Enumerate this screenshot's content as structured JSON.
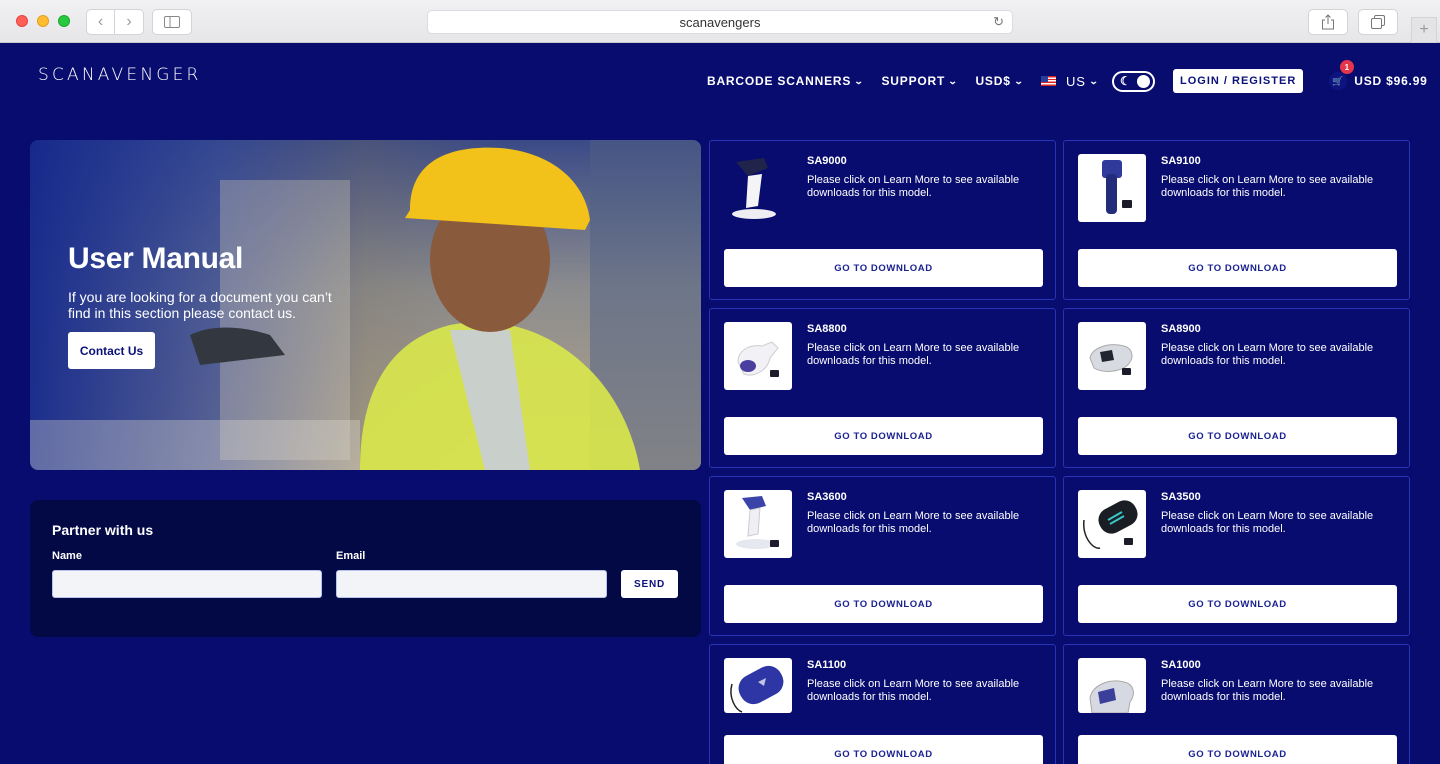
{
  "browser": {
    "url": "scanavengers"
  },
  "header": {
    "logo": "SCANAVENGER",
    "nav": [
      {
        "label": "BARCODE SCANNERS"
      },
      {
        "label": "SUPPORT"
      },
      {
        "label": "USD$"
      },
      {
        "label": "US"
      }
    ],
    "login_label": "LOGIN / REGISTER",
    "cart": {
      "count": "1",
      "total": "USD $96.99"
    }
  },
  "hero": {
    "title": "User Manual",
    "text": "If you are looking for a document you can’t find in this section please contact us.",
    "button": "Contact Us"
  },
  "partner": {
    "title": "Partner with us",
    "name_label": "Name",
    "email_label": "Email",
    "send_label": "SEND"
  },
  "products": [
    {
      "name": "SA9000",
      "desc": "Please click on Learn More to see available downloads for this model.",
      "button": "GO TO DOWNLOAD",
      "thumb_icon": "stand-scanner-icon"
    },
    {
      "name": "SA9100",
      "desc": "Please click on Learn More to see available downloads for this model.",
      "button": "GO TO DOWNLOAD",
      "thumb_icon": "handheld-scanner-icon"
    },
    {
      "name": "SA8800",
      "desc": "Please click on Learn More to see available downloads for this model.",
      "button": "GO TO DOWNLOAD",
      "thumb_icon": "handheld-scanner-icon"
    },
    {
      "name": "SA8900",
      "desc": "Please click on Learn More to see available downloads for this model.",
      "button": "GO TO DOWNLOAD",
      "thumb_icon": "handheld-scanner-icon"
    },
    {
      "name": "SA3600",
      "desc": "Please click on Learn More to see available downloads for this model.",
      "button": "GO TO DOWNLOAD",
      "thumb_icon": "stand-scanner-icon"
    },
    {
      "name": "SA3500",
      "desc": "Please click on Learn More to see available downloads for this model.",
      "button": "GO TO DOWNLOAD",
      "thumb_icon": "pocket-scanner-icon"
    },
    {
      "name": "SA1100",
      "desc": "Please click on Learn More to see available downloads for this model.",
      "button": "GO TO DOWNLOAD",
      "thumb_icon": "pocket-scanner-icon"
    },
    {
      "name": "SA1000",
      "desc": "Please click on Learn More to see available downloads for this model.",
      "button": "GO TO DOWNLOAD",
      "thumb_icon": "handheld-scanner-icon"
    }
  ]
}
